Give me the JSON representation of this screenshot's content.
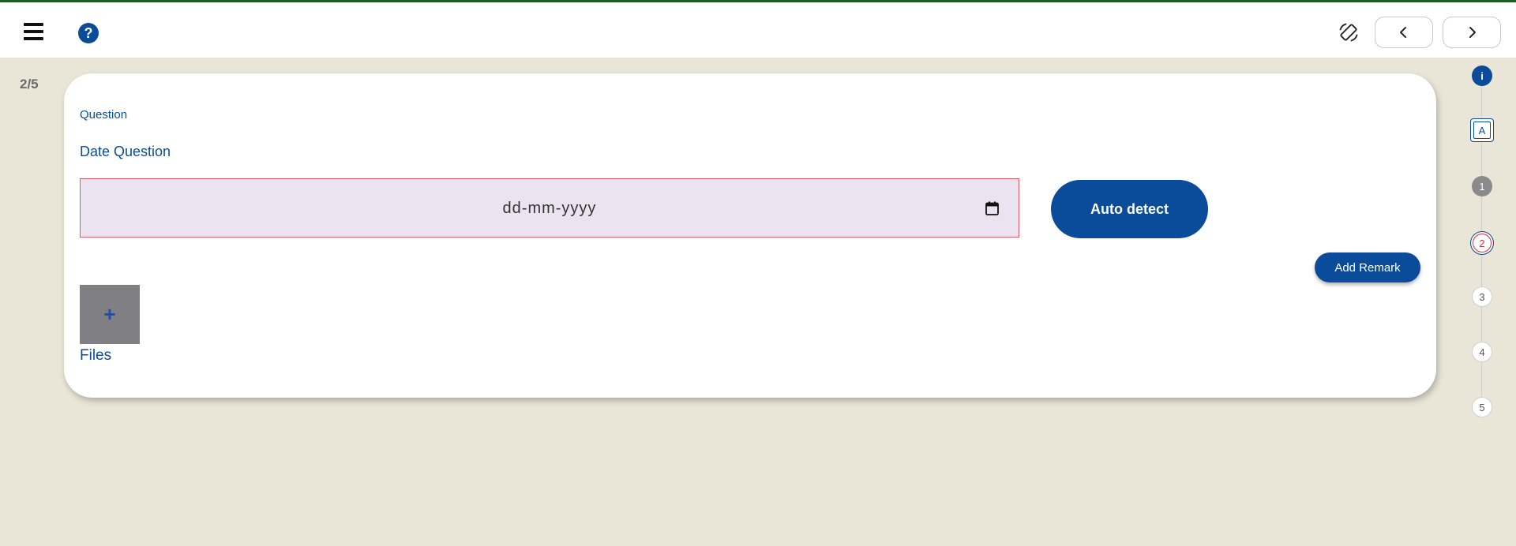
{
  "header": {
    "menu_icon": "hamburger-menu-icon",
    "help_symbol": "?",
    "rotate_icon": "screen-rotation-icon",
    "prev_icon": "chevron-left-icon",
    "next_icon": "chevron-right-icon"
  },
  "progress": {
    "label": "2/5",
    "current": 2,
    "total": 5
  },
  "question": {
    "section_label": "Question",
    "title": "Date Question",
    "date_placeholder": "dd-mm-yyyy",
    "calendar_icon": "calendar-icon",
    "auto_detect_label": "Auto detect",
    "add_remark_label": "Add Remark",
    "add_file_symbol": "+",
    "files_label": "Files"
  },
  "stepper": {
    "info_label": "i",
    "a_label": "A",
    "steps": [
      "1",
      "2",
      "3",
      "4",
      "5"
    ]
  },
  "colors": {
    "primary": "#0a4c99",
    "background": "#e9e6d7",
    "error_border": "#e05a66",
    "input_fill": "#ece3f1",
    "top_accent": "#1f5a23"
  }
}
